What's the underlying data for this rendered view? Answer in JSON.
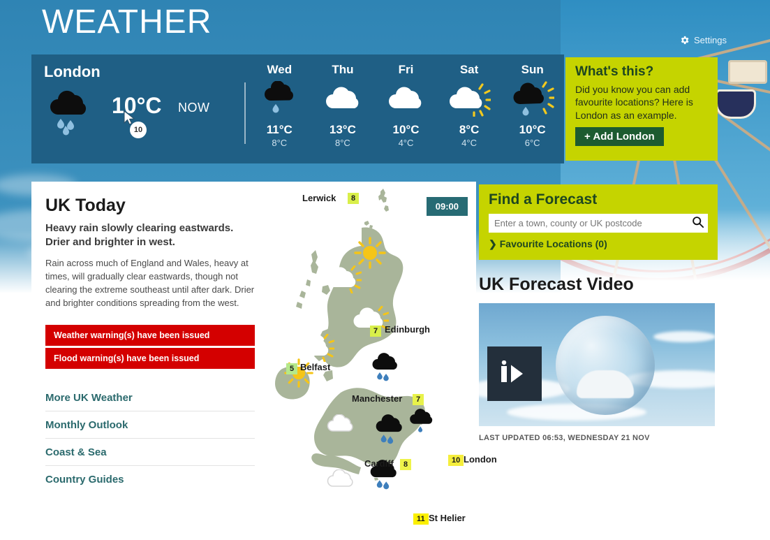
{
  "header": {
    "title": "WEATHER",
    "settings_label": "Settings",
    "settings_icon": "gear-icon"
  },
  "forecast_strip": {
    "location": "London",
    "now_temp": "10°C",
    "now_label": "NOW",
    "now_icon": "heavy-rain-shower-icon",
    "cursor_badge": "10",
    "days": [
      {
        "name": "Wed",
        "icon": "light-rain-shower-icon",
        "max": "11°C",
        "min": "8°C"
      },
      {
        "name": "Thu",
        "icon": "cloudy-icon",
        "max": "13°C",
        "min": "8°C"
      },
      {
        "name": "Fri",
        "icon": "cloudy-icon",
        "max": "10°C",
        "min": "4°C"
      },
      {
        "name": "Sat",
        "icon": "sunny-intervals-icon",
        "max": "8°C",
        "min": "4°C"
      },
      {
        "name": "Sun",
        "icon": "sunny-rain-shower-icon",
        "max": "10°C",
        "min": "6°C"
      }
    ]
  },
  "whats_this": {
    "heading": "What's this?",
    "body": "Did you know you can add favourite locations? Here is London as an example.",
    "add_button": "+ Add London"
  },
  "uk_today": {
    "heading": "UK Today",
    "summary": "Heavy rain slowly clearing eastwards. Drier and brighter in west.",
    "body": "Rain across much of England and Wales, heavy at times, will gradually clear eastwards, though not clearing the extreme southeast until after dark. Drier and brighter conditions spreading from the west.",
    "warnings": [
      "Weather warning(s) have been issued",
      "Flood warning(s) have been issued"
    ],
    "links": [
      "More UK Weather",
      "Monthly Outlook",
      "Coast & Sea",
      "Country Guides"
    ]
  },
  "map": {
    "time_badge": "09:00",
    "cities": [
      {
        "name": "Lerwick",
        "temp": "8",
        "pill_color": "#d9ef4a",
        "label_side": "left"
      },
      {
        "name": "Edinburgh",
        "temp": "7",
        "pill_color": "#d9ef4a",
        "label_side": "right"
      },
      {
        "name": "Belfast",
        "temp": "5",
        "pill_color": "#b5e88a",
        "label_side": "right"
      },
      {
        "name": "Manchester",
        "temp": "7",
        "pill_color": "#e8f24a",
        "label_side": "left"
      },
      {
        "name": "Cardiff",
        "temp": "8",
        "pill_color": "#eef34a",
        "label_side": "left"
      },
      {
        "name": "London",
        "temp": "10",
        "pill_color": "#f5ee3c",
        "label_side": "right"
      },
      {
        "name": "St Helier",
        "temp": "11",
        "pill_color": "#fbf000",
        "label_side": "right"
      }
    ]
  },
  "find_forecast": {
    "heading": "Find a Forecast",
    "search_placeholder": "Enter a town, county or UK postcode",
    "search_value": "",
    "search_icon": "search-icon",
    "favourites_label": "Favourite Locations (0)"
  },
  "video": {
    "heading": "UK Forecast Video",
    "play_icon": "play-icon",
    "last_updated": "LAST UPDATED 06:53, WEDNESDAY 21 NOV"
  },
  "colors": {
    "accent_green": "#c5d400",
    "strip_blue": "#1f5f85",
    "warning_red": "#d40000",
    "link_teal": "#2b6a6d",
    "dark_green": "#1d5b30",
    "map_land": "#a9b59a"
  }
}
